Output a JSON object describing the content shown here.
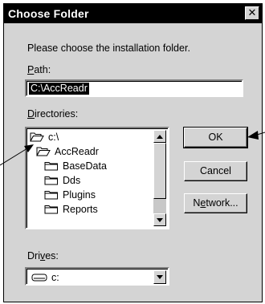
{
  "dialog": {
    "title": "Choose Folder",
    "close_glyph": "✕",
    "prompt": "Please choose the installation folder."
  },
  "path": {
    "label_underlined": "P",
    "label_rest": "ath:",
    "value": "C:\\AccReadr"
  },
  "directories": {
    "label_underlined": "D",
    "label_rest": "irectories:",
    "items": [
      {
        "label": "c:\\",
        "icon": "open-folder-icon",
        "level": 0
      },
      {
        "label": "AccReadr",
        "icon": "open-folder-icon",
        "level": 1
      },
      {
        "label": "BaseData",
        "icon": "folder-icon",
        "level": 2
      },
      {
        "label": "Dds",
        "icon": "folder-icon",
        "level": 2
      },
      {
        "label": "Plugins",
        "icon": "folder-icon",
        "level": 2
      },
      {
        "label": "Reports",
        "icon": "folder-icon",
        "level": 2
      }
    ]
  },
  "buttons": {
    "ok": "OK",
    "cancel": "Cancel",
    "network_pre": "N",
    "network_underlined": "e",
    "network_post": "twork..."
  },
  "drives": {
    "label_pre": "Dri",
    "label_underlined": "v",
    "label_post": "es:",
    "value": "c:",
    "icon": "drive-icon"
  }
}
